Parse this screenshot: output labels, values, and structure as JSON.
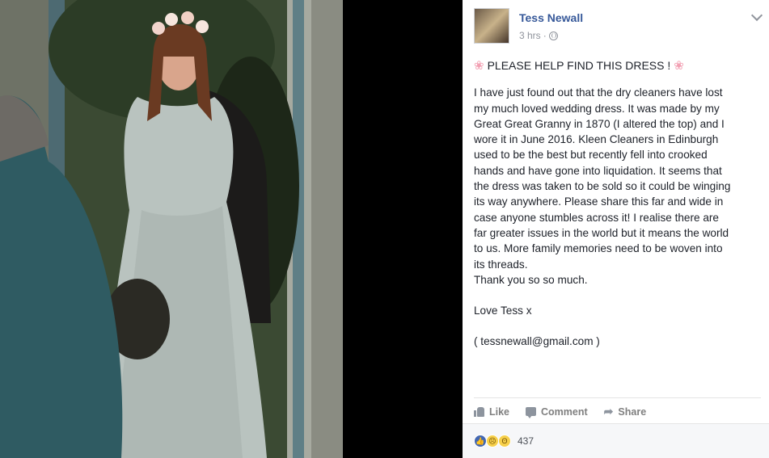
{
  "post": {
    "author": "Tess Newall",
    "time": "3 hrs",
    "separator": "·",
    "headline": "PLEASE HELP FIND THIS DRESS !",
    "body_lines": [
      "I have just found out that the dry cleaners have lost",
      "my much loved wedding dress. It was made by my",
      "Great Great Granny in 1870 (I altered the top) and I",
      "wore it in June 2016. Kleen Cleaners in Edinburgh",
      "used to be the best but recently fell into crooked",
      "hands and have gone into liquidation. It seems that",
      "the dress was taken to be sold so it could be winging",
      "its way anywhere. Please share this far and wide in",
      "case anyone stumbles across it! I realise there are",
      "far greater issues in the world but it means the world",
      "to us. More family memories need to be woven into",
      "its threads.",
      "Thank you so so much."
    ],
    "signoff": "Love Tess x",
    "contact": "( tessnewall@gmail.com )",
    "icon_headline": "cherry-blossom-icon",
    "icon_privacy": "globe-icon"
  },
  "actions": {
    "like": "Like",
    "comment": "Comment",
    "share": "Share"
  },
  "reactions": {
    "count": "437",
    "types": [
      "like",
      "sad",
      "wow"
    ]
  },
  "colors": {
    "author_link": "#365899",
    "meta": "#90949c",
    "like_blue": "#4267b2"
  }
}
